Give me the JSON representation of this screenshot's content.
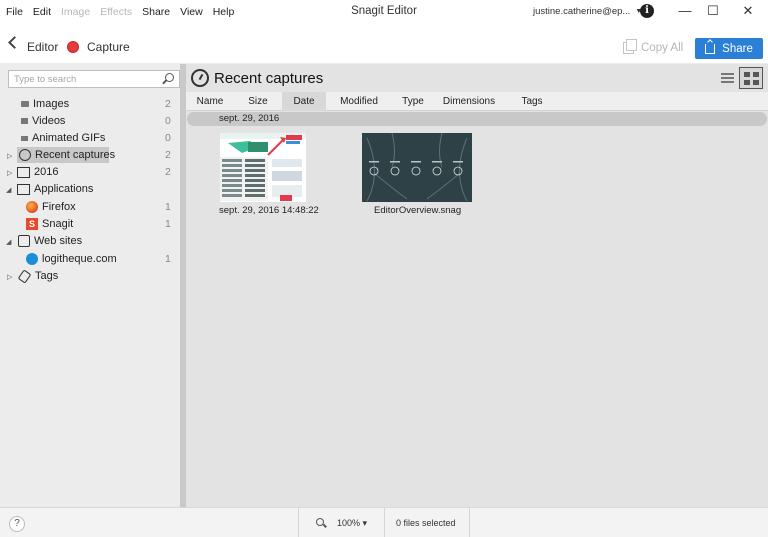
{
  "menu": {
    "items": [
      {
        "label": "File",
        "enabled": true
      },
      {
        "label": "Edit",
        "enabled": true
      },
      {
        "label": "Image",
        "enabled": false
      },
      {
        "label": "Effects",
        "enabled": false
      },
      {
        "label": "Share",
        "enabled": true
      },
      {
        "label": "View",
        "enabled": true
      },
      {
        "label": "Help",
        "enabled": true
      }
    ]
  },
  "window": {
    "title": "Snagit Editor",
    "account": "justine.catherine@ep...",
    "minimize": "—",
    "maximize": "☐",
    "close": "✕"
  },
  "toolbar": {
    "editor_label": "Editor",
    "capture_label": "Capture",
    "copy_all_label": "Copy All",
    "share_label": "Share",
    "share_color": "#2b7fd4",
    "capture_color": "#e63b3b"
  },
  "search": {
    "placeholder": "Type to search"
  },
  "sidebar": {
    "items": [
      {
        "label": "Images",
        "count": "2",
        "icon": "image-icon"
      },
      {
        "label": "Videos",
        "count": "0",
        "icon": "video-icon"
      },
      {
        "label": "Animated GIFs",
        "count": "0",
        "icon": "gif-icon"
      },
      {
        "label": "Recent captures",
        "count": "2",
        "icon": "clock-icon",
        "selected": true
      },
      {
        "label": "2016",
        "count": "2",
        "icon": "folder-icon"
      },
      {
        "label": "Applications",
        "count": "",
        "icon": "applications-icon"
      },
      {
        "label": "Firefox",
        "count": "1",
        "icon": "firefox-icon"
      },
      {
        "label": "Snagit",
        "count": "1",
        "icon": "snagit-icon"
      },
      {
        "label": "Web sites",
        "count": "",
        "icon": "web-icon"
      },
      {
        "label": "logitheque.com",
        "count": "1",
        "icon": "logitheque-icon"
      },
      {
        "label": "Tags",
        "count": "",
        "icon": "tag-icon"
      }
    ]
  },
  "main": {
    "title": "Recent captures",
    "columns": [
      "Name",
      "Size",
      "Date",
      "Modified",
      "Type",
      "Dimensions",
      "Tags"
    ],
    "active_column": "Date",
    "group_label": "sept. 29, 2016",
    "thumbnails": [
      {
        "label": "sept. 29, 2016 14:48:22"
      },
      {
        "label": "EditorOverview.snag"
      }
    ]
  },
  "status": {
    "help": "?",
    "zoom": "100% ▾",
    "files_selected": "0 files selected"
  }
}
